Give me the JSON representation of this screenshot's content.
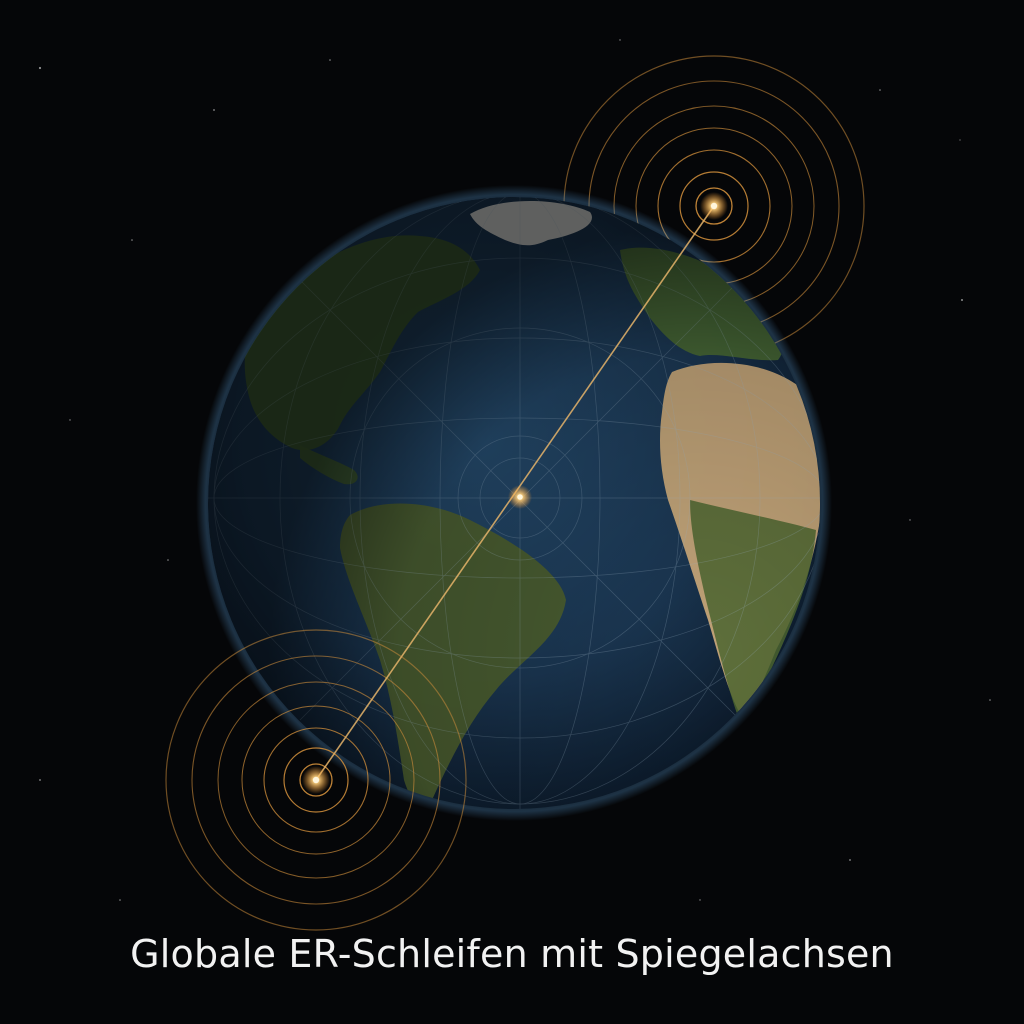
{
  "caption": "Globale ER-Schleifen mit Spiegelachsen",
  "colors": {
    "space": "#050608",
    "ocean": "#1d3a52",
    "land_green": "#3c5a2e",
    "land_desert": "#c9a97a",
    "ice": "#e8e8e4",
    "ring": "#c98a3a",
    "node": "#ffd890",
    "axis": "#e6b46a"
  },
  "icons": {
    "globe": "earth-globe-icon",
    "node": "glowing-node-icon"
  }
}
